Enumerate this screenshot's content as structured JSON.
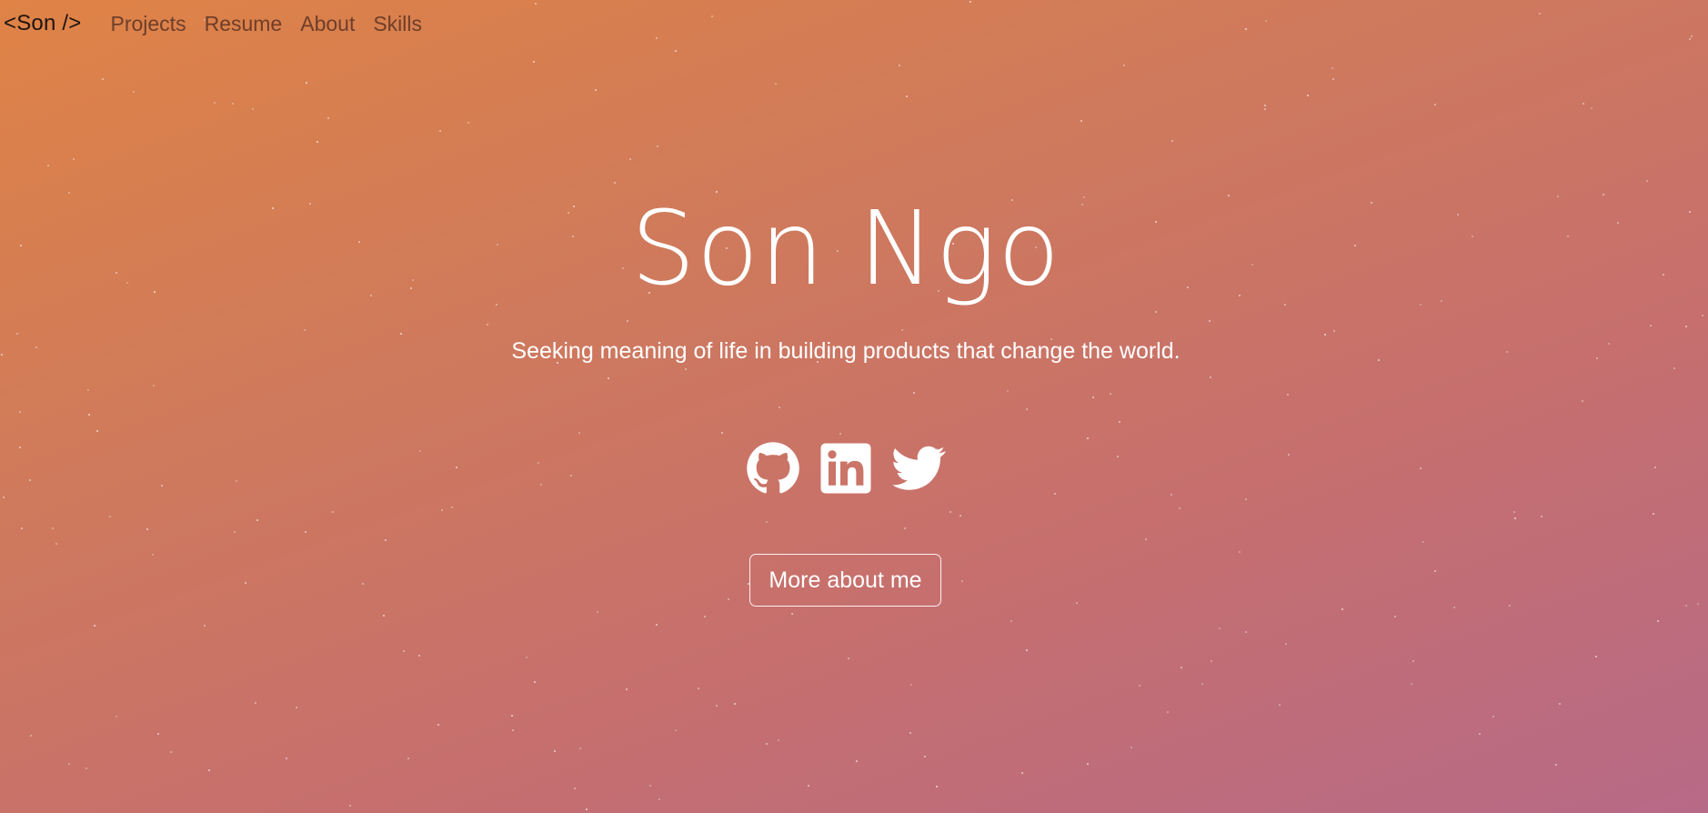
{
  "nav": {
    "brand": "<Son />",
    "links": [
      "Projects",
      "Resume",
      "About",
      "Skills"
    ]
  },
  "hero": {
    "name": "Son Ngo",
    "tagline": "Seeking meaning of life in building products that change the world.",
    "button_label": "More about me"
  },
  "socials": [
    {
      "name": "github",
      "icon": "github-icon"
    },
    {
      "name": "linkedin",
      "icon": "linkedin-icon"
    },
    {
      "name": "twitter",
      "icon": "twitter-icon"
    }
  ],
  "colors": {
    "gradient_start": "#df8346",
    "gradient_end": "#b76a87",
    "text": "#ffffff",
    "nav_link": "#6e3e2a"
  }
}
